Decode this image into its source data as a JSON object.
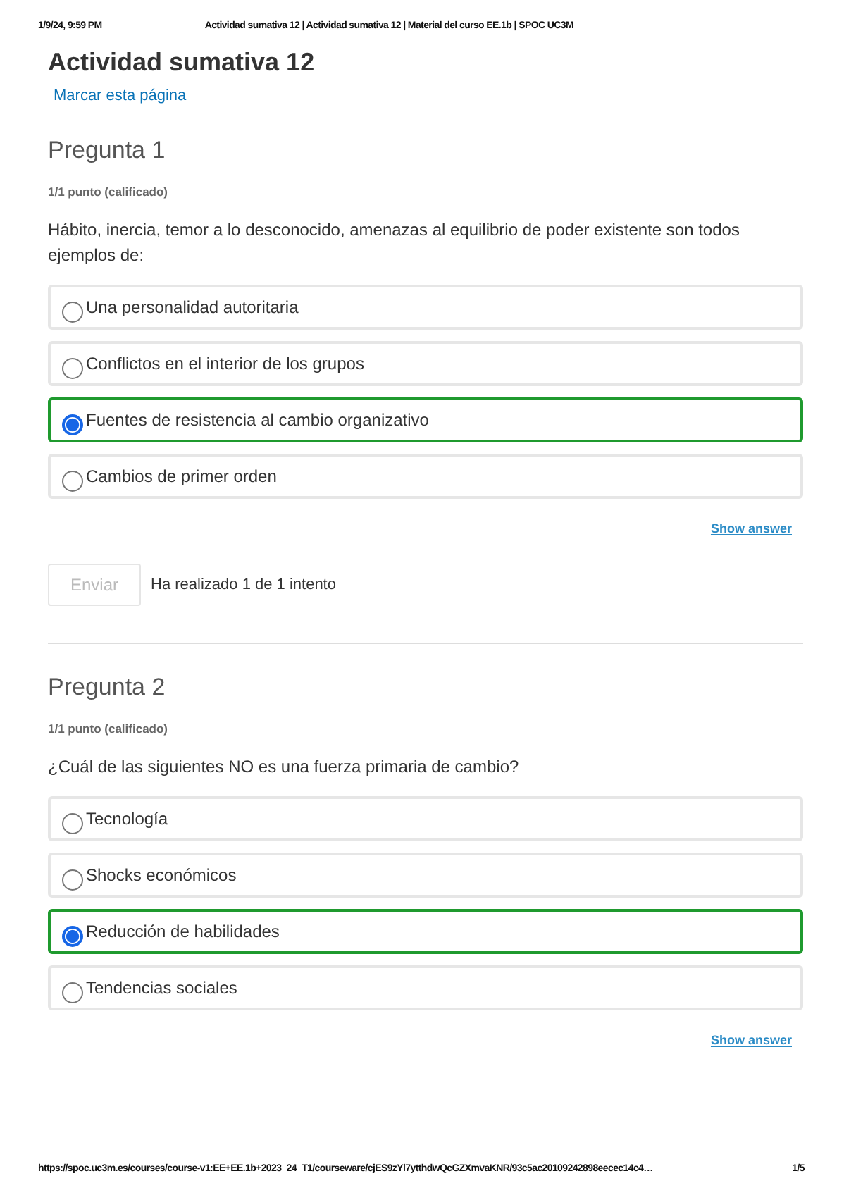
{
  "header": {
    "datetime": "1/9/24, 9:59 PM",
    "title": "Actividad sumativa 12 | Actividad sumativa 12 | Material del curso EE.1b | SPOC UC3M"
  },
  "page": {
    "title": "Actividad sumativa 12",
    "bookmark": "Marcar esta página"
  },
  "questions": [
    {
      "title": "Pregunta 1",
      "score": "1/1 punto (calificado)",
      "prompt": "Hábito, inercia, temor a lo desconocido, amenazas al equilibrio de poder existente son todos ejemplos de:",
      "options": [
        {
          "label": "Una personalidad autoritaria",
          "selected": false
        },
        {
          "label": "Conflictos en el interior de los grupos",
          "selected": false
        },
        {
          "label": "Fuentes de resistencia al cambio organizativo",
          "selected": true
        },
        {
          "label": "Cambios de primer orden",
          "selected": false
        }
      ],
      "show_answer": "Show answer",
      "submit": {
        "label": "Enviar",
        "disabled": true
      },
      "attempts": "Ha realizado 1 de 1 intento"
    },
    {
      "title": "Pregunta 2",
      "score": "1/1 punto (calificado)",
      "prompt": "¿Cuál de las siguientes NO es una fuerza primaria de cambio?",
      "options": [
        {
          "label": "Tecnología",
          "selected": false
        },
        {
          "label": "Shocks económicos",
          "selected": false
        },
        {
          "label": "Reducción de habilidades",
          "selected": true
        },
        {
          "label": "Tendencias sociales",
          "selected": false
        }
      ],
      "show_answer": "Show answer"
    }
  ],
  "footer": {
    "url": "https://spoc.uc3m.es/courses/course-v1:EE+EE.1b+2023_24_T1/courseware/cjES9zYl7ytthdwQcGZXmvaKNR/93c5ac20109242898eecec14c4…",
    "page": "1/5"
  }
}
